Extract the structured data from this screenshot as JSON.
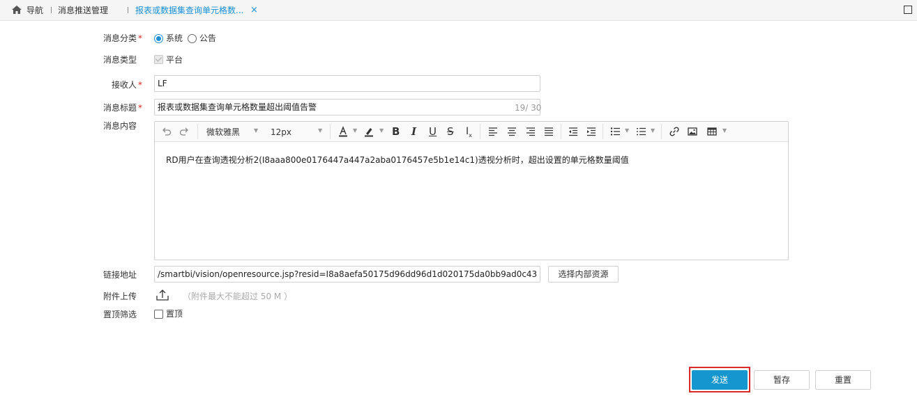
{
  "topbar": {
    "home_icon": "home-icon",
    "nav_label": "导航",
    "tab_message_mgmt": "消息推送管理",
    "tab_active": "报表或数据集查询单元格数...",
    "close_glyph": "×",
    "maximize_icon": "maximize-icon",
    "accent": "#1a8fd8"
  },
  "form": {
    "category": {
      "label": "消息分类",
      "required": "*",
      "options": [
        "系统",
        "公告"
      ],
      "selected": "系统"
    },
    "type": {
      "label": "消息类型",
      "option": "平台"
    },
    "recipient": {
      "label": "接收人",
      "required": "*",
      "value": "LF"
    },
    "title": {
      "label": "消息标题",
      "required": "*",
      "value": "报表或数据集查询单元格数量超出阈值告警",
      "counter": "19/ 30"
    },
    "content": {
      "label": "消息内容",
      "font_family": "微软雅黑",
      "font_size": "12px",
      "text": "RD用户在查询透视分析2(I8aaa800e0176447a447a2aba0176457e5b1e14c1)透视分析时，超出设置的单元格数量阈值"
    },
    "link": {
      "label": "链接地址",
      "value": "/smartbi/vision/openresource.jsp?resid=I8a8aefa50175d96dd96d1d020175da0bb9ad0c43",
      "button": "选择内部资源"
    },
    "attachment": {
      "label": "附件上传",
      "hint": "（附件最大不能超过 50 M ）",
      "icon": "upload-icon"
    },
    "pin": {
      "label": "置顶筛选",
      "option": "置顶"
    }
  },
  "actions": {
    "send": "发送",
    "save_draft": "暂存",
    "reset": "重置"
  },
  "colors": {
    "primary": "#1596ce",
    "required": "#e0231d",
    "focus": "#d92b2b"
  }
}
